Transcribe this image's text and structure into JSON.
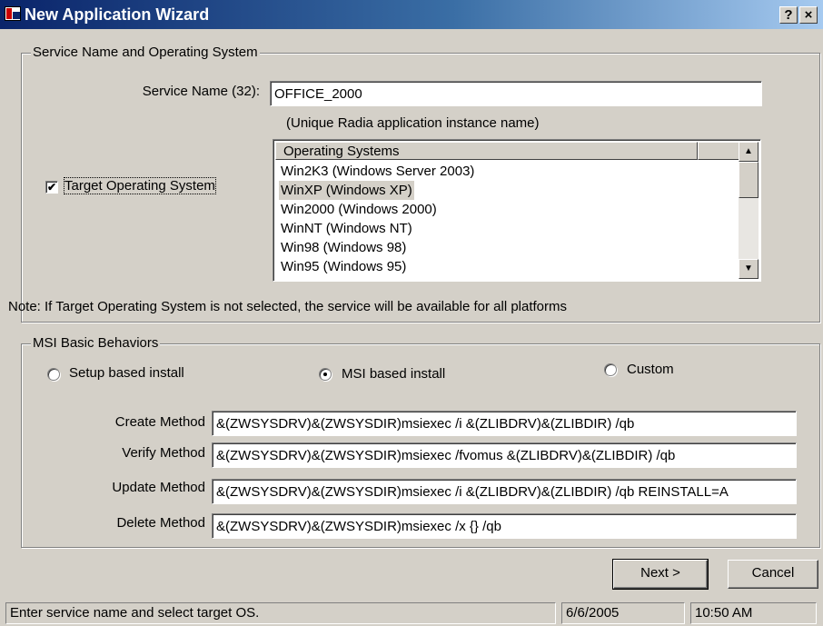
{
  "window": {
    "title": "New Application Wizard",
    "help_glyph": "?",
    "close_glyph": "×"
  },
  "service_section": {
    "legend": "Service Name and Operating System",
    "service_name_label": "Service Name (32):",
    "service_name_value": "OFFICE_2000",
    "service_name_hint": "(Unique Radia application instance name)",
    "target_os_label": "Target Operating System",
    "target_os_checked": true,
    "check_glyph": "✔",
    "os_list": {
      "header": "Operating Systems",
      "items": [
        "Win2K3 (Windows Server 2003)",
        "WinXP (Windows XP)",
        "Win2000 (Windows 2000)",
        "WinNT (Windows NT)",
        "Win98 (Windows 98)",
        "Win95 (Windows 95)"
      ],
      "selected_index": 1,
      "scroll_up_glyph": "▲",
      "scroll_down_glyph": "▼"
    },
    "note": "Note: If Target Operating System is not selected, the service will be available for all platforms"
  },
  "msi_section": {
    "legend": "MSI Basic Behaviors",
    "options": {
      "setup": "Setup based install",
      "msi": "MSI based install",
      "custom": "Custom"
    },
    "selected_option": "msi",
    "methods": {
      "create_label": "Create Method",
      "create_value": "&(ZWSYSDRV)&(ZWSYSDIR)msiexec /i &(ZLIBDRV)&(ZLIBDIR) /qb",
      "verify_label": "Verify Method",
      "verify_value": "&(ZWSYSDRV)&(ZWSYSDIR)msiexec /fvomus &(ZLIBDRV)&(ZLIBDIR) /qb",
      "update_label": "Update Method",
      "update_value": "&(ZWSYSDRV)&(ZWSYSDIR)msiexec /i &(ZLIBDRV)&(ZLIBDIR) /qb REINSTALL=A",
      "delete_label": "Delete Method",
      "delete_value": "&(ZWSYSDRV)&(ZWSYSDIR)msiexec /x {} /qb"
    }
  },
  "buttons": {
    "next": "Next >",
    "cancel": "Cancel"
  },
  "status_bar": {
    "message": "Enter service name and select target OS.",
    "date": "6/6/2005",
    "time": "10:50 AM"
  }
}
